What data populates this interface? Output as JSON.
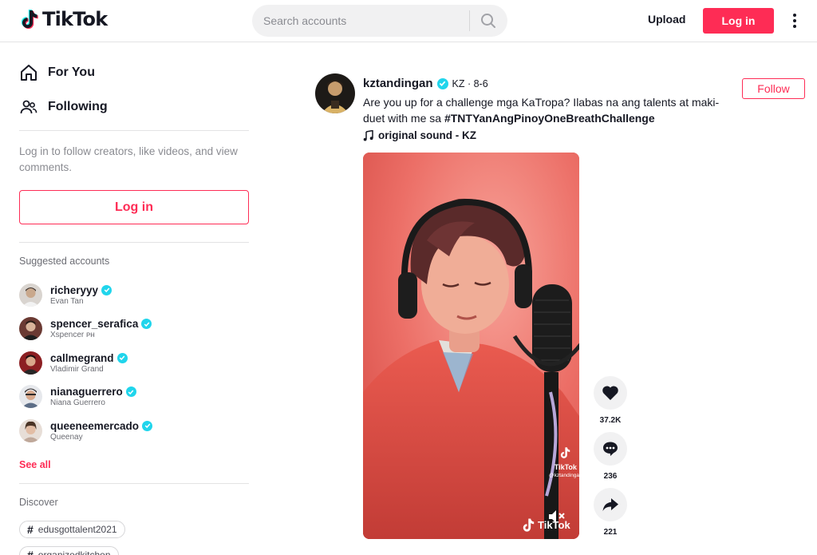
{
  "header": {
    "logo_text": "TikTok",
    "search_placeholder": "Search accounts",
    "upload_label": "Upload",
    "login_label": "Log in"
  },
  "sidebar": {
    "nav": [
      {
        "label": "For You",
        "icon": "home-icon"
      },
      {
        "label": "Following",
        "icon": "users-icon"
      }
    ],
    "login_hint": "Log in to follow creators, like videos, and view comments.",
    "login_button": "Log in",
    "suggested_title": "Suggested accounts",
    "accounts": [
      {
        "handle": "richeryyy",
        "nickname": "Evan Tan",
        "verified": true
      },
      {
        "handle": "spencer_serafica",
        "nickname": "Xspencer ᴘʜ",
        "verified": true
      },
      {
        "handle": "callmegrand",
        "nickname": "Vladimir Grand",
        "verified": true
      },
      {
        "handle": "nianaguerrero",
        "nickname": "Niana Guerrero",
        "verified": true
      },
      {
        "handle": "queeneemercado",
        "nickname": "Queenay",
        "verified": true
      }
    ],
    "see_all": "See all",
    "discover_title": "Discover",
    "tags": [
      "edusgottalent2021",
      "organizedkitchen"
    ]
  },
  "post": {
    "handle": "kztandingan",
    "meta": "KZ · 8-6",
    "desc_text": "Are you up for a challenge mga KaTropa? Ilabas na ang talents at maki-duet with me sa ",
    "desc_hashtag": "#TNTYanAngPinoyOneBreathChallenge",
    "sound": "original sound - KZ",
    "follow_label": "Follow",
    "watermark_small": "TikTok",
    "watermark_user": "@kztandingan",
    "watermark_big": "TikTok",
    "likes": "37.2K",
    "comments": "236",
    "shares": "221"
  },
  "colors": {
    "brand": "#fe2c55",
    "verified": "#20d5ec",
    "text": "#161823",
    "muted": "#8a8b91"
  }
}
